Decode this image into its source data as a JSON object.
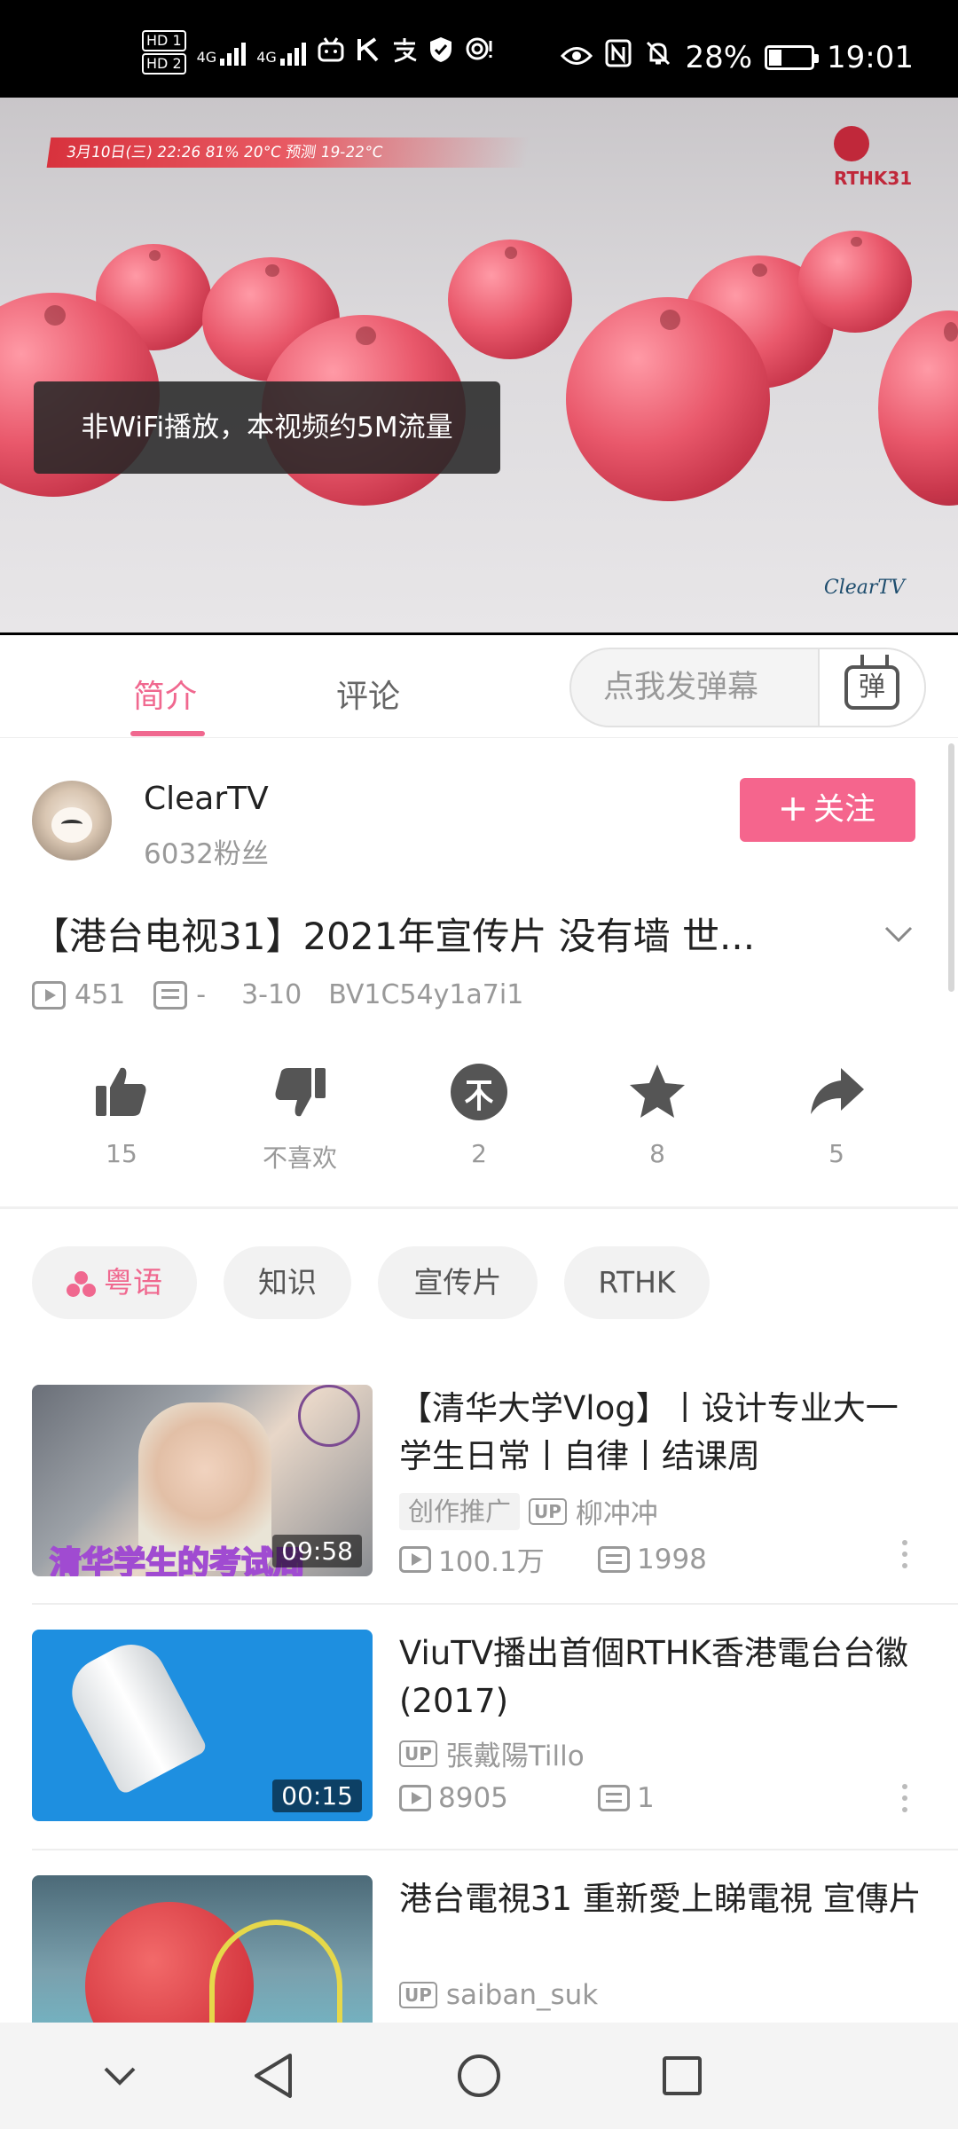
{
  "status_bar": {
    "network_labels": [
      "HD 1",
      "HD 2",
      "4G",
      "4G"
    ],
    "battery": "28%",
    "time": "19:01"
  },
  "video": {
    "ticker": "3月10日(三)  22:26  81%  20°C  预测 19-22°C",
    "channel_logo": "RTHK31",
    "toast": "非WiFi播放，本视频约5M流量",
    "watermark": "ClearTV"
  },
  "tabs": [
    {
      "label": "简介",
      "active": true
    },
    {
      "label": "评论",
      "active": false
    }
  ],
  "danmaku": {
    "placeholder": "点我发弹幕",
    "button_glyph": "弹"
  },
  "uploader": {
    "name": "ClearTV",
    "fans": "6032粉丝",
    "follow_label": "关注"
  },
  "video_info": {
    "title": "【港台电视31】2021年宣传片 没有墙 世...",
    "views": "451",
    "danmaku_count": "-",
    "date": "3-10",
    "bvid": "BV1C54y1a7i1"
  },
  "actions": [
    {
      "name": "like",
      "icon": "thumbs-up-icon",
      "label": "15"
    },
    {
      "name": "dislike",
      "icon": "thumbs-down-icon",
      "label": "不喜欢"
    },
    {
      "name": "coin",
      "icon": "coin-icon",
      "label": "2"
    },
    {
      "name": "favorite",
      "icon": "star-icon",
      "label": "8"
    },
    {
      "name": "share",
      "icon": "share-icon",
      "label": "5"
    }
  ],
  "tags": [
    "粤语",
    "知识",
    "宣传片",
    "RTHK"
  ],
  "related": [
    {
      "title": "【清华大学Vlog】丨设计专业大一学生日常丨自律丨结课周",
      "thumb_text": "清华学生的考试周",
      "badge": "创作推广",
      "uploader": "柳冲冲",
      "duration": "09:58",
      "views": "100.1万",
      "danmaku": "1998"
    },
    {
      "title": "ViuTV播出首個RTHK香港電台台徽 (2017)",
      "badge": "",
      "uploader": "張戴陽Tillo",
      "duration": "00:15",
      "views": "8905",
      "danmaku": "1"
    },
    {
      "title": "港台電視31 重新愛上睇電視 宣傳片",
      "badge": "",
      "uploader": "saiban_suk",
      "duration": "",
      "views": "",
      "danmaku": ""
    }
  ],
  "up_label": "UP",
  "colors": {
    "accent": "#f0688f",
    "follow": "#f5658d",
    "muted": "#999999"
  }
}
